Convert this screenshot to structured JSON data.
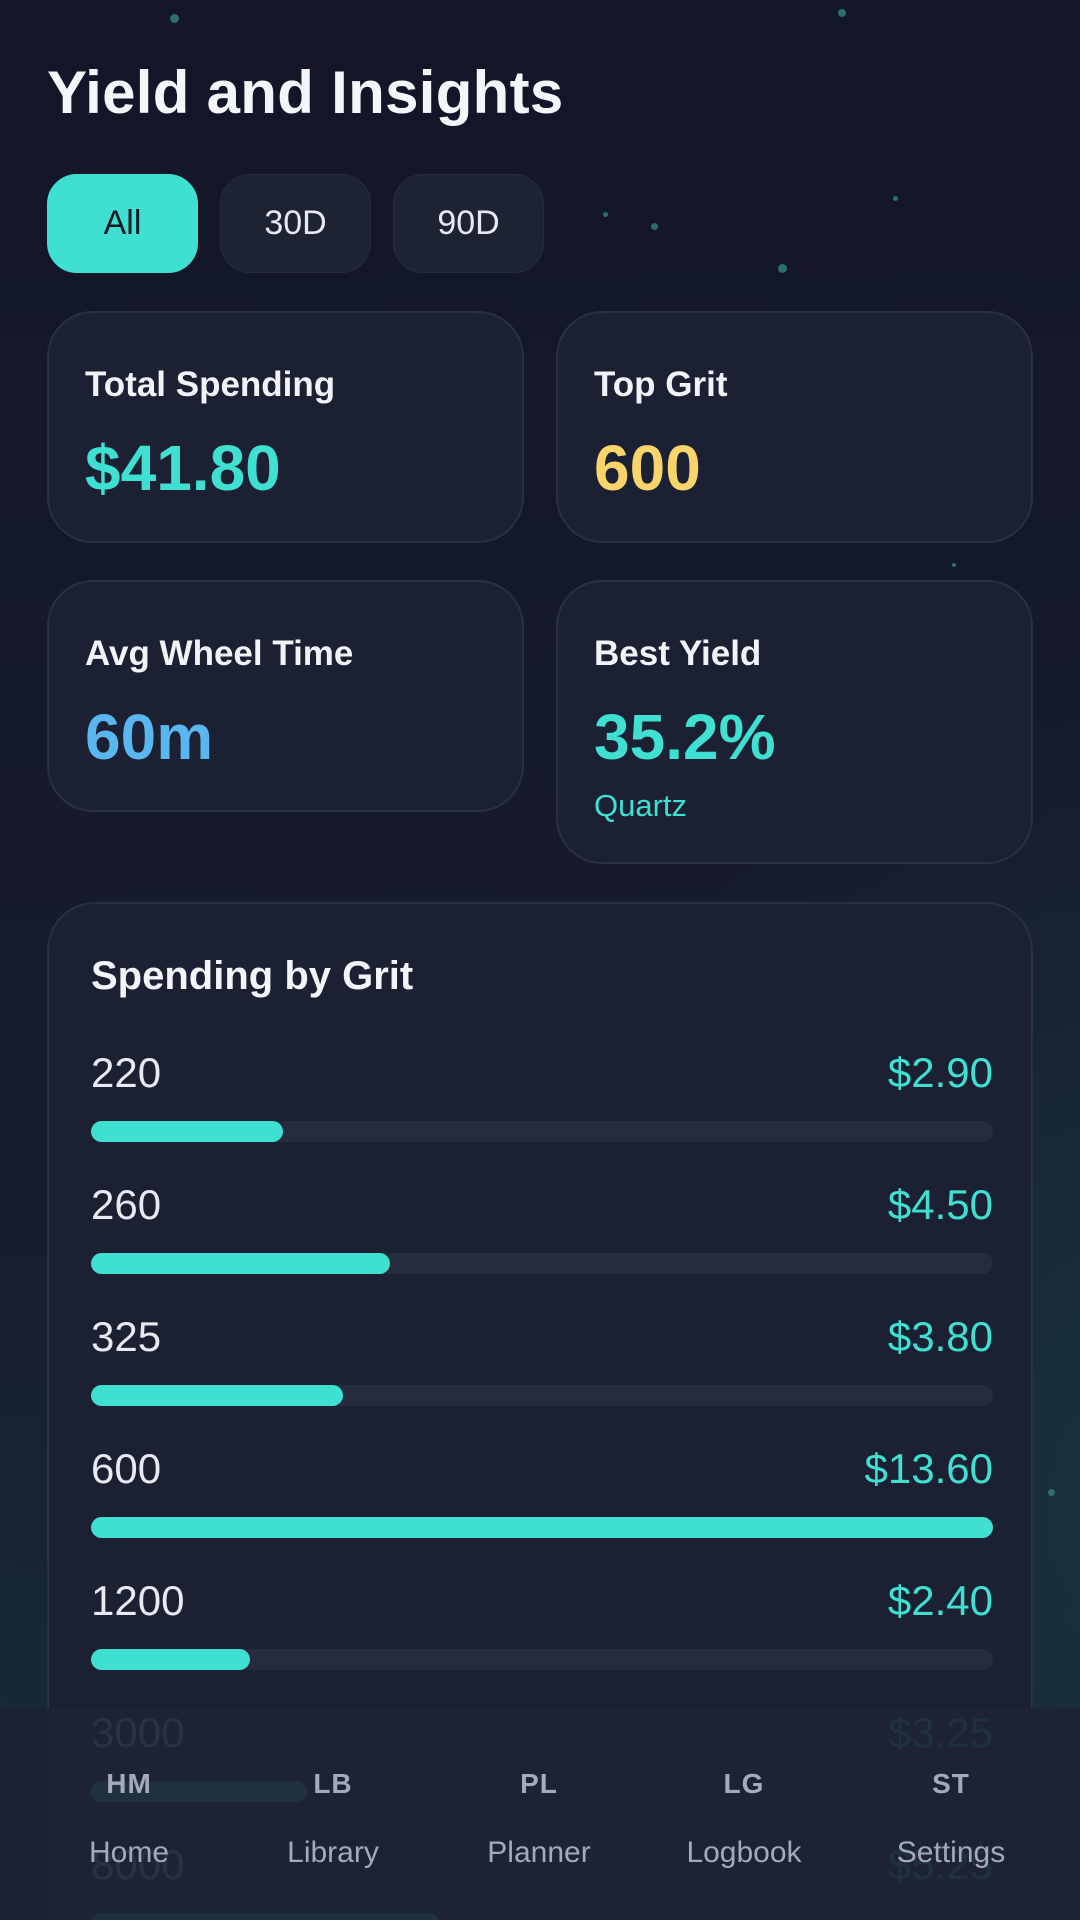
{
  "header": {
    "title": "Yield and Insights"
  },
  "filters": [
    {
      "label": "All",
      "active": true
    },
    {
      "label": "30D",
      "active": false
    },
    {
      "label": "90D",
      "active": false
    }
  ],
  "stats": {
    "total_spending": {
      "label": "Total Spending",
      "value": "$41.80",
      "color": "#3fe0d2"
    },
    "top_grit": {
      "label": "Top Grit",
      "value": "600",
      "color": "#f7d56b"
    },
    "avg_wheel_time": {
      "label": "Avg Wheel Time",
      "value": "60m",
      "color": "#59b6ee"
    },
    "best_yield": {
      "label": "Best Yield",
      "value": "35.2%",
      "sub": "Quartz",
      "color": "#3fe0d2"
    }
  },
  "spending_by_grit": {
    "title": "Spending by Grit",
    "rows": [
      {
        "grit": "220",
        "amount": "$2.90",
        "fraction": 0.213
      },
      {
        "grit": "260",
        "amount": "$4.50",
        "fraction": 0.331
      },
      {
        "grit": "325",
        "amount": "$3.80",
        "fraction": 0.279
      },
      {
        "grit": "600",
        "amount": "$13.60",
        "fraction": 1.0
      },
      {
        "grit": "1200",
        "amount": "$2.40",
        "fraction": 0.176
      },
      {
        "grit": "3000",
        "amount": "$3.25",
        "fraction": 0.239
      },
      {
        "grit": "8000",
        "amount": "$5.25",
        "fraction": 0.386
      }
    ]
  },
  "nav": [
    {
      "abbr": "HM",
      "label": "Home"
    },
    {
      "abbr": "LB",
      "label": "Library"
    },
    {
      "abbr": "PL",
      "label": "Planner"
    },
    {
      "abbr": "LG",
      "label": "Logbook"
    },
    {
      "abbr": "ST",
      "label": "Settings"
    }
  ]
}
